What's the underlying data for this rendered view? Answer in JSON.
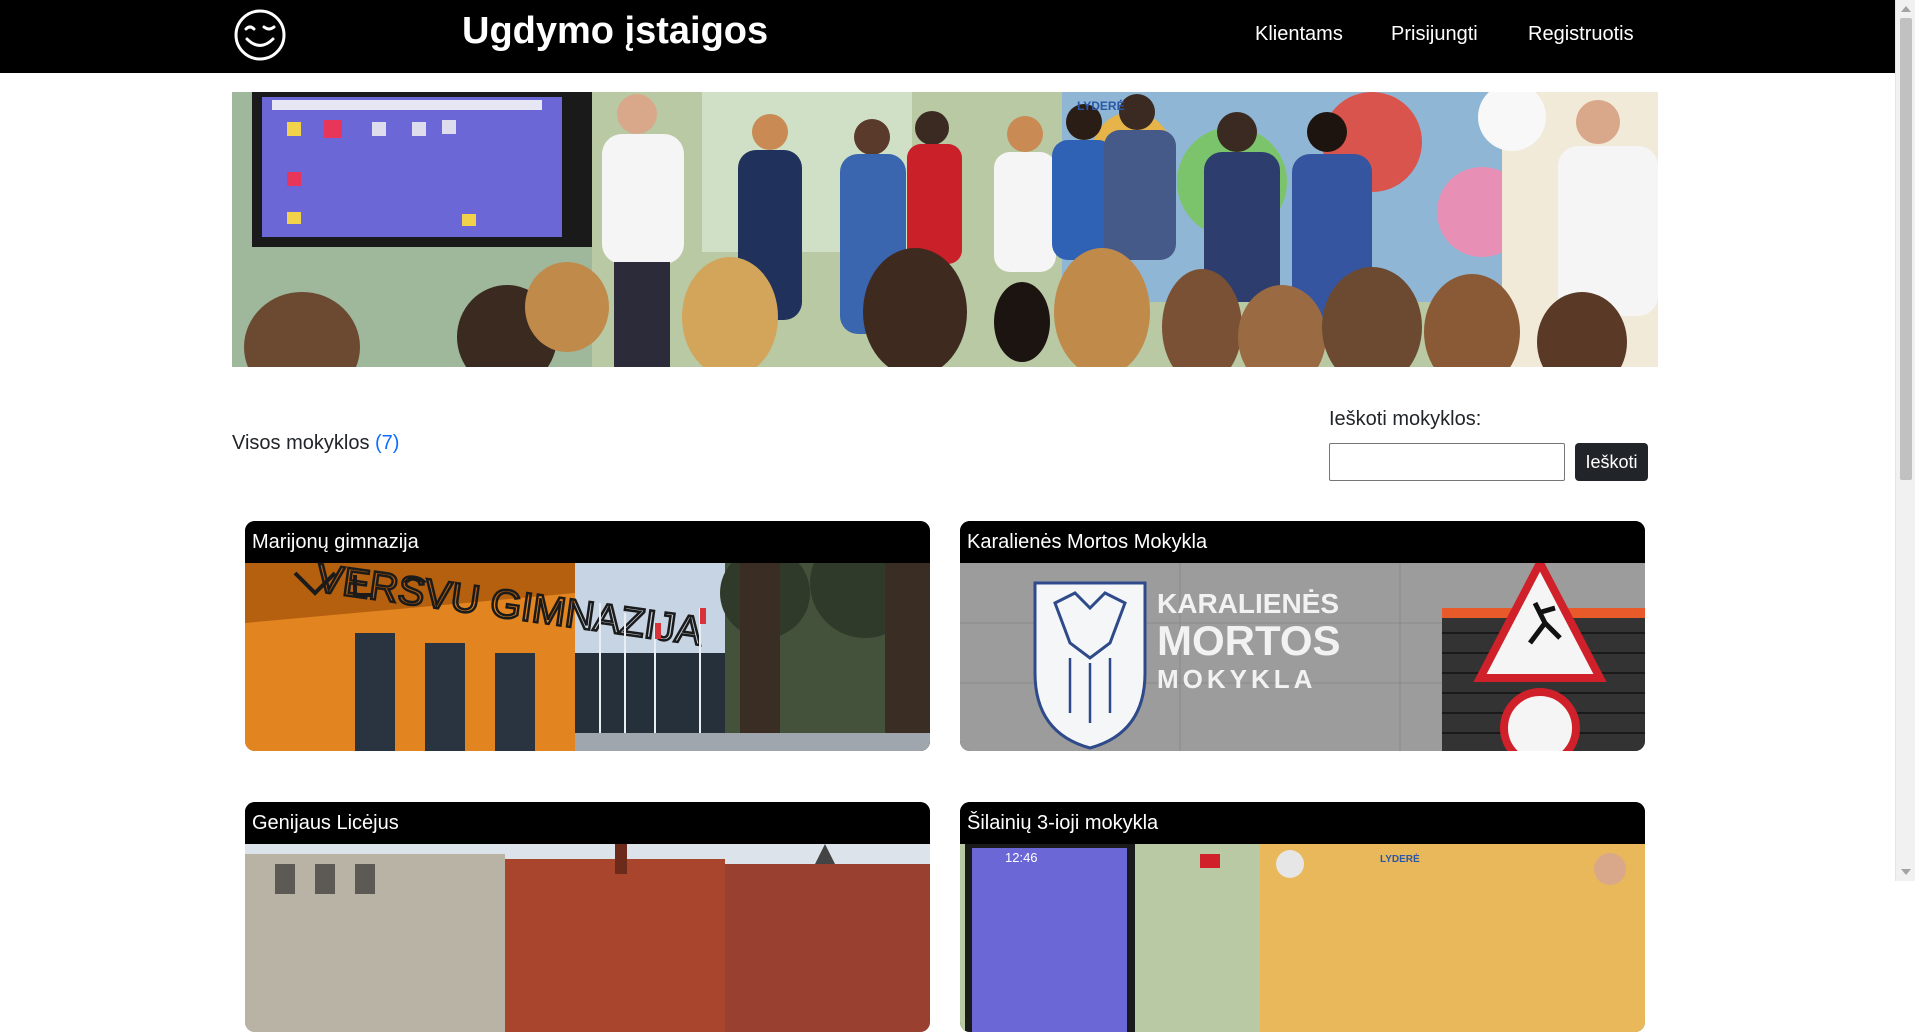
{
  "navbar": {
    "brand": "Ugdymo įstaigos",
    "logo_icon": "smiley-face-icon",
    "links": [
      {
        "label": "Klientams"
      },
      {
        "label": "Prisijungti"
      },
      {
        "label": "Registruotis"
      }
    ]
  },
  "hero": {
    "description_icon": "classroom-photo"
  },
  "listing": {
    "label": "Visos mokyklos",
    "count": "(7)"
  },
  "search": {
    "label": "Ieškoti mokyklos:",
    "input_value": "",
    "button_label": "Ieškoti"
  },
  "schools": [
    {
      "name": "Marijonų gimnazija"
    },
    {
      "name": "Karalienės Mortos Mokykla"
    },
    {
      "name": "Genijaus Licėjus"
    },
    {
      "name": "Šilainių 3-ioji mokykla"
    }
  ],
  "card_image_text": {
    "sign_line1": "KARALIENĖS",
    "sign_line2": "MORTOS",
    "sign_line3": "MOKYKLA",
    "facade_text": "VERSVU GIMNAZIJA",
    "clock_text": "12:46",
    "banner_text": "LYDERĖ"
  },
  "colors": {
    "navbar_bg": "#000000",
    "accent": "#0d6efd",
    "button_bg": "#212529"
  }
}
